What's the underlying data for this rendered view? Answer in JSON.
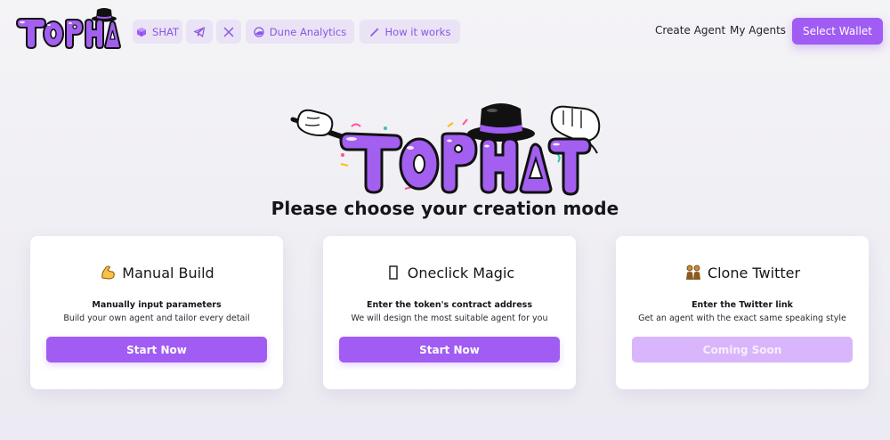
{
  "nav": {
    "logo_text": "TOP HAT",
    "token_label": "SHAT",
    "dune_label": "Dune Analytics",
    "how_label": "How it works",
    "create_agent": "Create Agent",
    "my_agents": "My Agents",
    "wallet_button": "Select Wallet"
  },
  "hero": {
    "logo_text": "TOP HAT",
    "headline": "Please choose your creation mode"
  },
  "cards": [
    {
      "icon": "flexed-biceps-icon",
      "title": "Manual Build",
      "subtitle": "Manually input parameters",
      "description": "Build your own agent and tailor every detail",
      "button": "Start Now",
      "enabled": true
    },
    {
      "icon": "missing-glyph-icon",
      "title": "Oneclick Magic",
      "subtitle": "Enter the token's contract address",
      "description": "We will design the most suitable agent for you",
      "button": "Start Now",
      "enabled": true
    },
    {
      "icon": "twins-icon",
      "title": "Clone Twitter",
      "subtitle": "Enter the Twitter link",
      "description": "Get an agent with the exact same speaking style",
      "button": "Coming Soon",
      "enabled": false
    }
  ],
  "colors": {
    "accent": "#a05cf3",
    "accent_disabled": "#d9b6fb",
    "pill_bg": "#e9e3f5",
    "pill_text": "#8b55e6"
  }
}
